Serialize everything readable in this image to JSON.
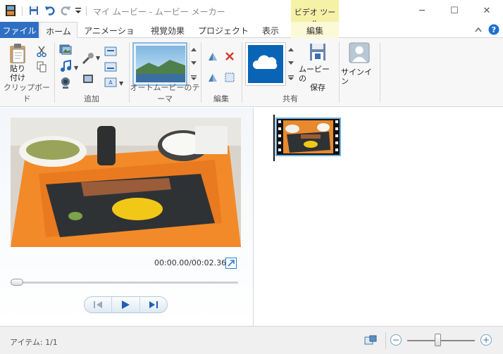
{
  "window": {
    "title": "マイ ムービー - ムービー メーカー",
    "context_tab": "ビデオ ツール",
    "minimize_label": "─",
    "maximize_label": "☐",
    "close_label": "✕"
  },
  "tabs": [
    {
      "label": "ファイル"
    },
    {
      "label": "ホーム"
    },
    {
      "label": "アニメーション"
    },
    {
      "label": "視覚効果"
    },
    {
      "label": "プロジェクト"
    },
    {
      "label": "表示"
    },
    {
      "label": "編集"
    }
  ],
  "ribbon": {
    "paste_label_1": "貼り",
    "paste_label_2": "付け",
    "groups": {
      "clipboard": "クリップボード",
      "add": "追加",
      "themes": "オートムービーのテーマ",
      "edit": "編集",
      "share": "共有"
    },
    "save_movie_label_1": "ムービーの",
    "save_movie_label_2": "保存",
    "signin_label": "サインイン"
  },
  "player": {
    "time": "00:00.00/00:02.36",
    "seek_position": 0
  },
  "status": {
    "items_text": "アイテム: 1/1",
    "zoom_position": 0.45
  },
  "colors": {
    "accent": "#2e6fc3",
    "context_tab": "#f5f1a6",
    "onedrive": "#0a64b5"
  }
}
